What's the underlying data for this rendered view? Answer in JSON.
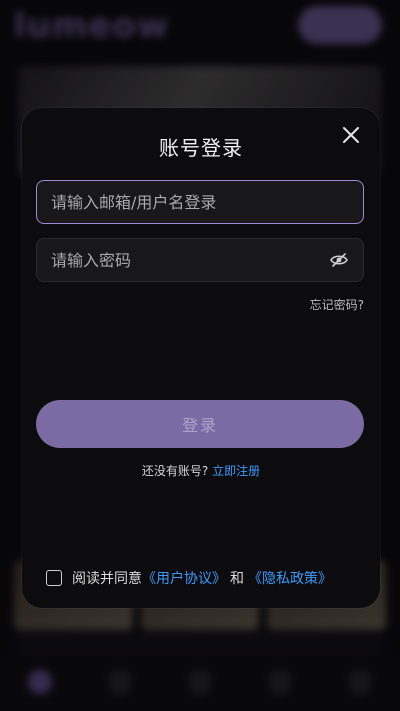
{
  "background": {
    "logo_text": "lumeow",
    "top_button_label": "",
    "banner_text": "",
    "tag_text": "",
    "nav_items": [
      {
        "label": "",
        "active": true
      },
      {
        "label": ""
      },
      {
        "label": ""
      },
      {
        "label": ""
      },
      {
        "label": ""
      }
    ]
  },
  "modal": {
    "title": "账号登录",
    "close_icon": "close-icon",
    "email_placeholder": "请输入邮箱/用户名登录",
    "email_value": "",
    "password_placeholder": "请输入密码",
    "password_value": "",
    "password_toggle_icon": "eye-off-icon",
    "forgot_label": "忘记密码?",
    "login_label": "登录",
    "register_prompt": "还没有账号?",
    "register_link": "立即注册",
    "agreement_prefix": "阅读并同意",
    "user_agreement_link": "《用户协议》",
    "agreement_and": "和",
    "privacy_policy_link": "《隐私政策》",
    "agreement_checked": false
  },
  "colors": {
    "accent": "#7c6aa4",
    "link": "#3b9bff",
    "active_border": "#9c8ad6",
    "modal_bg": "#0c0b0d"
  }
}
